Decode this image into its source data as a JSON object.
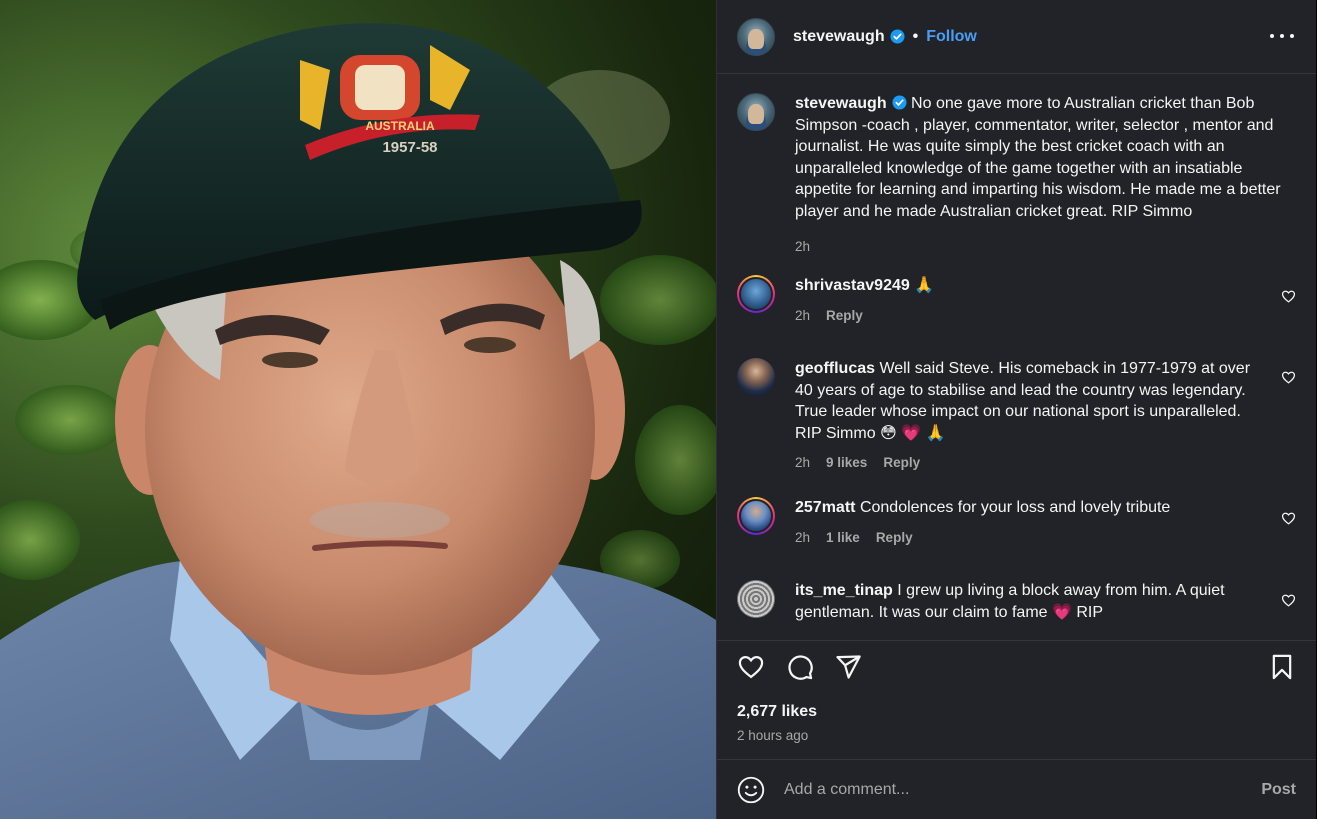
{
  "post": {
    "author": "stevewaugh",
    "follow_label": "Follow",
    "caption": "No one gave more to Australian cricket than Bob Simpson -coach , player, commentator, writer, selector , mentor and journalist. He was quite simply the best cricket coach with an unparalleled knowledge of the game together with an insatiable appetite for learning and imparting his wisdom. He made me a better player and he made Australian cricket great. RIP Simmo",
    "caption_time": "2h",
    "cap_text": {
      "country": "AUSTRALIA",
      "years": "1957-58"
    },
    "likes": "2,677 likes",
    "posted": "2 hours ago"
  },
  "comments": [
    {
      "user": "shrivastav9249",
      "text": "🙏",
      "time": "2h",
      "likes": "",
      "reply": "Reply"
    },
    {
      "user": "geofflucas",
      "text": "Well said Steve. His comeback in 1977-1979 at over 40 years of age to stabilise and lead the country was legendary. True leader whose impact on our national sport is unparalleled. RIP Simmo 😳 💗 🙏",
      "time": "2h",
      "likes": "9 likes",
      "reply": "Reply"
    },
    {
      "user": "257matt",
      "text": "Condolences for your loss and lovely tribute",
      "time": "2h",
      "likes": "1 like",
      "reply": "Reply"
    },
    {
      "user": "its_me_tinap",
      "text": "I grew up living a block away from him. A quiet gentleman. It was our claim to fame 💗 RIP"
    }
  ],
  "compose": {
    "placeholder": "Add a comment...",
    "post_label": "Post"
  },
  "icons": {
    "more": "more-options-icon",
    "verified": "verified-badge-icon",
    "like": "heart-icon",
    "comment": "comment-icon",
    "share": "send-icon",
    "save": "bookmark-icon",
    "emoji": "smiley-icon"
  },
  "colors": {
    "panel_bg": "#212328",
    "accent": "#4a9df3",
    "muted": "#a8a8a8",
    "verified": "#1d9bf0"
  }
}
